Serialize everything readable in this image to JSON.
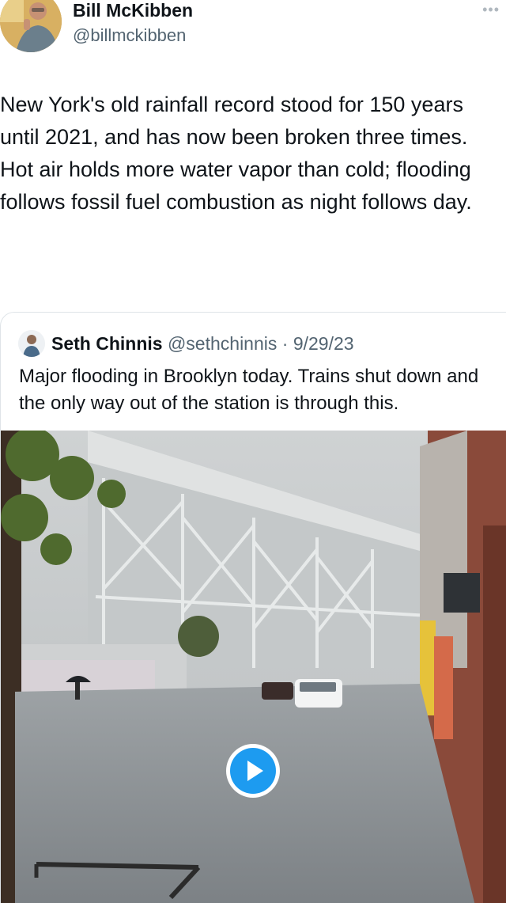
{
  "author": {
    "name": "Bill McKibben",
    "handle": "@billmckibben",
    "more_icon": "more-dots-icon"
  },
  "tweet": {
    "lines": [
      "New York's old rainfall record stood for 150 years until 2021, and has now been broken three times.",
      "Hot air holds more water vapor than cold; flooding follows fossil fuel combustion as night follows day."
    ]
  },
  "quote": {
    "name": "Seth Chinnis",
    "handle": "@sethchinnis",
    "separator": "·",
    "date": "9/29/23",
    "text": "Major flooding in Brooklyn today. Trains shut down and the only way out of the station is through this.",
    "media": {
      "type": "video",
      "play_icon": "play-icon",
      "play_color": "#1d9bf0"
    }
  }
}
